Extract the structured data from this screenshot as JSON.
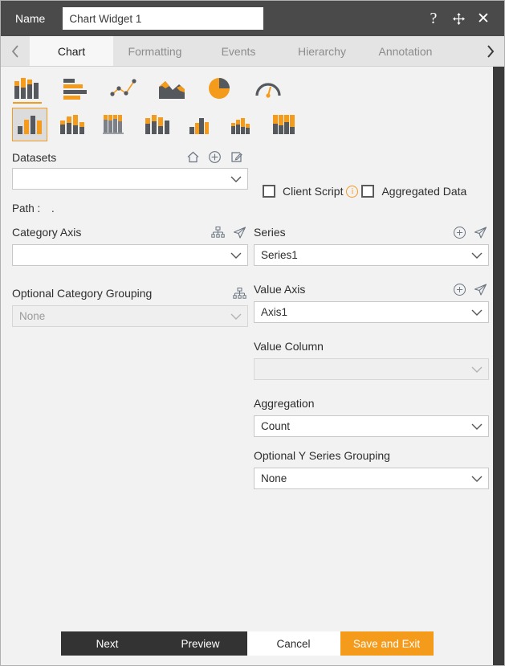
{
  "titlebar": {
    "name_label": "Name",
    "name_value": "Chart Widget 1",
    "help_icon": "question-mark-icon",
    "move_icon": "move-cross-icon",
    "close_icon": "close-x-icon"
  },
  "tabbar": {
    "prev_arrow": "‹",
    "next_arrow": "›",
    "tabs": [
      {
        "label": "Chart",
        "active": true
      },
      {
        "label": "Formatting",
        "active": false
      },
      {
        "label": "Events",
        "active": false
      },
      {
        "label": "Hierarchy",
        "active": false
      },
      {
        "label": "Annotation",
        "active": false
      }
    ]
  },
  "chart_types": [
    {
      "name": "column-chart-icon",
      "selected": true
    },
    {
      "name": "bar-chart-icon",
      "selected": false
    },
    {
      "name": "scatter-line-chart-icon",
      "selected": false
    },
    {
      "name": "area-chart-icon",
      "selected": false
    },
    {
      "name": "pie-chart-icon",
      "selected": false
    },
    {
      "name": "gauge-chart-icon",
      "selected": false
    }
  ],
  "chart_subtypes": [
    {
      "name": "clustered-column-icon",
      "selected": true
    },
    {
      "name": "stacked-column-icon",
      "selected": false
    },
    {
      "name": "stacked-column-grouped-icon",
      "selected": false
    },
    {
      "name": "clustered-stacked-column-icon",
      "selected": false
    },
    {
      "name": "overlapped-column-icon",
      "selected": false
    },
    {
      "name": "small-stacked-column-icon",
      "selected": false
    },
    {
      "name": "full-stacked-column-icon",
      "selected": false
    }
  ],
  "datasets": {
    "label": "Datasets",
    "home_icon": "home-icon",
    "add_icon": "plus-circle-icon",
    "edit_icon": "edit-pencil-icon",
    "select_value": "",
    "path_label": "Path :",
    "path_value": "."
  },
  "options": {
    "client_script": {
      "label": "Client Script",
      "checked": false,
      "info_icon": "info-circle-icon"
    },
    "aggregated_data": {
      "label": "Aggregated Data",
      "checked": false
    }
  },
  "left_column": {
    "category_axis": {
      "label": "Category Axis",
      "hierarchy_icon": "hierarchy-tree-icon",
      "navigate_icon": "paper-plane-icon",
      "value": "",
      "disabled": false
    },
    "optional_category_grouping": {
      "label": "Optional Category Grouping",
      "hierarchy_icon": "hierarchy-tree-icon",
      "value": "None",
      "disabled": true
    }
  },
  "right_column": {
    "series": {
      "label": "Series",
      "add_icon": "plus-circle-icon",
      "navigate_icon": "paper-plane-icon",
      "value": "Series1",
      "disabled": false
    },
    "value_axis": {
      "label": "Value Axis",
      "add_icon": "plus-circle-icon",
      "navigate_icon": "paper-plane-icon",
      "value": "Axis1",
      "disabled": false
    },
    "value_column": {
      "label": "Value Column",
      "value": "",
      "disabled": true
    },
    "aggregation": {
      "label": "Aggregation",
      "value": "Count",
      "disabled": false
    },
    "optional_y_series_grouping": {
      "label": "Optional Y Series Grouping",
      "value": "None",
      "disabled": false
    }
  },
  "footer": {
    "next": "Next",
    "preview": "Preview",
    "cancel": "Cancel",
    "save_and_exit": "Save and Exit"
  },
  "colors": {
    "accent": "#f59b1c",
    "titlebar": "#4a4a4a",
    "dark_button": "#333333",
    "icon_gray": "#55595e",
    "panel_bg": "#f2f2f2"
  }
}
